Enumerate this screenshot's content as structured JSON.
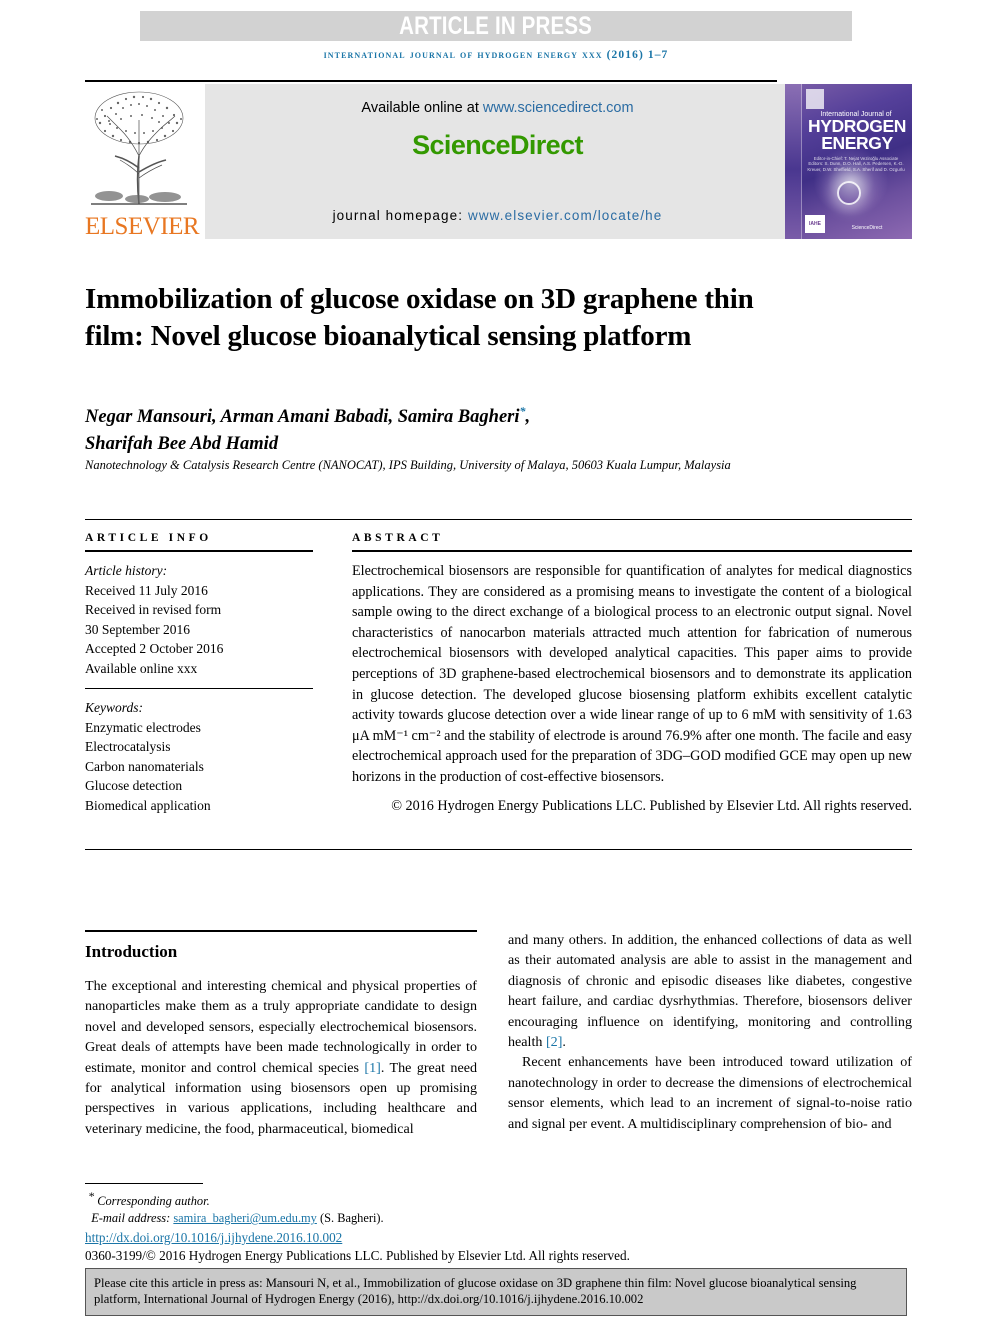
{
  "header": {
    "article_in_press": "ARTICLE IN PRESS",
    "running_head": "international journal of hydrogen energy xxx (2016) 1–7",
    "available_online_prefix": "Available online at ",
    "sciencedirect_url": "www.sciencedirect.com",
    "sciencedirect_logo": "ScienceDirect",
    "journal_homepage_prefix": "journal homepage: ",
    "journal_homepage_url": "www.elsevier.com/locate/he",
    "elsevier_wordmark": "ELSEVIER",
    "cover": {
      "line1": "International Journal of",
      "line2": "HYDROGEN",
      "line3": "ENERGY",
      "editors": "Editor-in-Chief: T. Nejat Veziroğlu   Associate Editors: S. Dunn, D.O. Hall, A.S. Pedersen, K.-D. Kreuer, D.W. Sheffield, S.A. Sherif and D. Ozgurlu",
      "badge": "IAHE",
      "sciencedirect": "ScienceDirect"
    }
  },
  "article": {
    "title": "Immobilization of glucose oxidase on 3D graphene thin film: Novel glucose bioanalytical sensing platform",
    "authors": "Negar Mansouri, Arman Amani Babadi, Samira Bagheri",
    "authors_line2": "Sharifah Bee Abd Hamid",
    "corresponding_marker": "*",
    "affiliation": "Nanotechnology & Catalysis Research Centre (NANOCAT), IPS Building, University of Malaya, 50603 Kuala Lumpur, Malaysia"
  },
  "article_info": {
    "heading": "ARTICLE INFO",
    "history_label": "Article history:",
    "history": [
      "Received 11 July 2016",
      "Received in revised form",
      "30 September 2016",
      "Accepted 2 October 2016",
      "Available online xxx"
    ],
    "keywords_label": "Keywords:",
    "keywords": [
      "Enzymatic electrodes",
      "Electrocatalysis",
      "Carbon nanomaterials",
      "Glucose detection",
      "Biomedical application"
    ]
  },
  "abstract": {
    "heading": "ABSTRACT",
    "text": "Electrochemical biosensors are responsible for quantification of analytes for medical diagnostics applications. They are considered as a promising means to investigate the content of a biological sample owing to the direct exchange of a biological process to an electronic output signal. Novel characteristics of nanocarbon materials attracted much attention for fabrication of numerous electrochemical biosensors with developed analytical capacities. This paper aims to provide perceptions of 3D graphene-based electrochemical biosensors and to demonstrate its application in glucose detection. The developed glucose biosensing platform exhibits excellent catalytic activity towards glucose detection over a wide linear range of up to 6 mM with sensitivity of 1.63 μA mM⁻¹ cm⁻² and the stability of electrode is around 76.9% after one month. The facile and easy electrochemical approach used for the preparation of 3DG–GOD modified GCE may open up new horizons in the production of cost-effective biosensors.",
    "copyright": "© 2016 Hydrogen Energy Publications LLC. Published by Elsevier Ltd. All rights reserved."
  },
  "body": {
    "introduction_heading": "Introduction",
    "left_paragraph_part1": "The exceptional and interesting chemical and physical properties of nanoparticles make them as a truly appropriate candidate to design novel and developed sensors, especially electrochemical biosensors. Great deals of attempts have been made technologically in order to estimate, monitor and control chemical species ",
    "left_citation_1": "[1]",
    "left_paragraph_part2": ". The great need for analytical information using biosensors open up promising perspectives in various applications, including healthcare and veterinary medicine, the food, pharmaceutical, biomedical",
    "right_paragraph1_part1": "and many others. In addition, the enhanced collections of data as well as their automated analysis are able to assist in the management and diagnosis of chronic and episodic diseases like diabetes, congestive heart failure, and cardiac dysrhythmias. Therefore, biosensors deliver encouraging influence on identifying, monitoring and controlling health ",
    "right_citation_2": "[2]",
    "right_paragraph1_part2": ".",
    "right_paragraph2": "Recent enhancements have been introduced toward utilization of nanotechnology in order to decrease the dimensions of electrochemical sensor elements, which lead to an increment of signal-to-noise ratio and signal per event. A multidisciplinary comprehension of bio- and"
  },
  "footnote": {
    "corresponding_marker": "*",
    "corresponding_author": "Corresponding author.",
    "email_label": "E-mail address: ",
    "email": "samira_bagheri@um.edu.my",
    "email_suffix": " (S. Bagheri).",
    "doi": "http://dx.doi.org/10.1016/j.ijhydene.2016.10.002",
    "issn_line": "0360-3199/© 2016 Hydrogen Energy Publications LLC. Published by Elsevier Ltd. All rights reserved."
  },
  "cite_box": {
    "text": "Please cite this article in press as: Mansouri N, et al., Immobilization of glucose oxidase on 3D graphene thin film: Novel glucose bioanalytical sensing platform, International Journal of Hydrogen Energy (2016), http://dx.doi.org/10.1016/j.ijhydene.2016.10.002"
  },
  "colors": {
    "link_blue": "#1a75a7",
    "sciencedirect_green": "#339900",
    "elsevier_orange": "#e87722",
    "band_gray": "#d2d2d2",
    "sd_box_gray": "#e5e5e5",
    "cite_box_gray": "#c9c9c9"
  }
}
